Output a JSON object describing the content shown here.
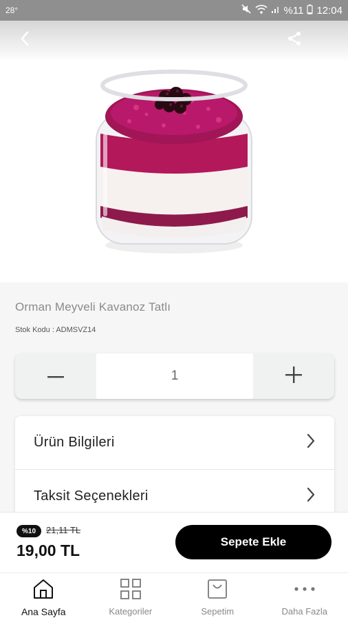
{
  "status_bar": {
    "left_text": "28°",
    "battery": "%11",
    "time": "12:04"
  },
  "product": {
    "title": "Orman Meyveli Kavanoz Tatlı",
    "stock_code": "Stok Kodu : ADMSVZ14"
  },
  "quantity": {
    "value": "1"
  },
  "info_rows": [
    {
      "label": "Ürün Bilgileri"
    },
    {
      "label": "Taksit Seçenekleri"
    }
  ],
  "pricing": {
    "discount_badge": "%10",
    "old_price": "21,11 TL",
    "price": "19,00 TL",
    "add_to_cart": "Sepete Ekle"
  },
  "tabs": [
    {
      "label": "Ana Sayfa",
      "icon": "home-icon",
      "active": true
    },
    {
      "label": "Kategoriler",
      "icon": "grid-icon",
      "active": false
    },
    {
      "label": "Sepetim",
      "icon": "cart-bag-icon",
      "active": false
    },
    {
      "label": "Daha Fazla",
      "icon": "more-dots-icon",
      "active": false
    }
  ]
}
